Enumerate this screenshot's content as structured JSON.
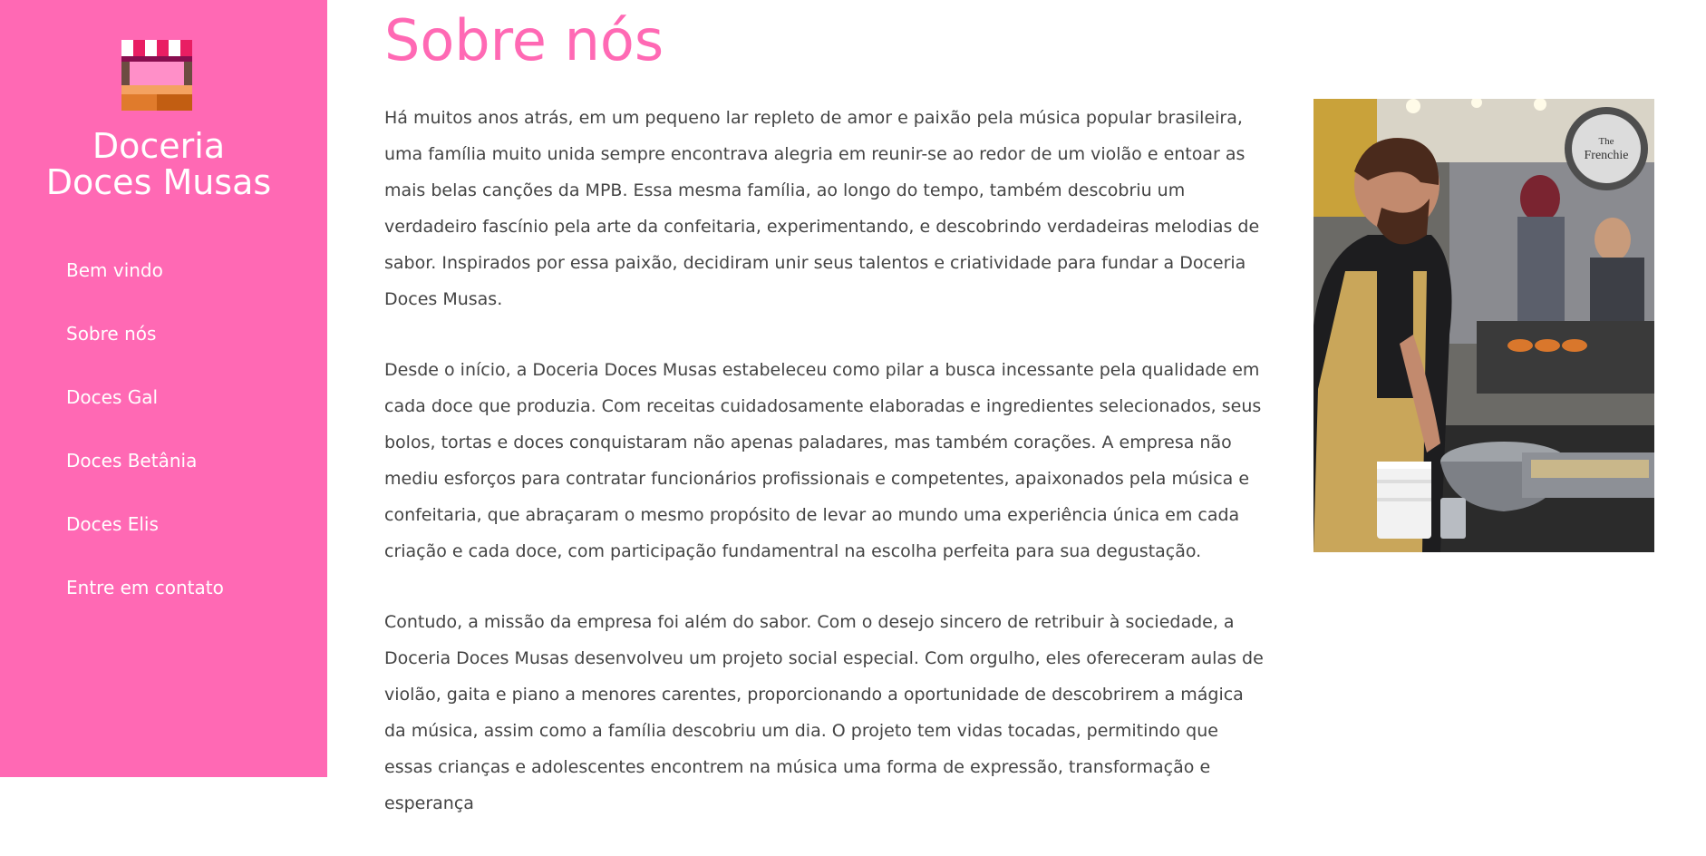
{
  "sidebar": {
    "brand_line1": "Doceria",
    "brand_line2": "Doces Musas",
    "logo_icon": "market-stall-icon",
    "nav": [
      {
        "label": "Bem vindo"
      },
      {
        "label": "Sobre nós"
      },
      {
        "label": "Doces Gal"
      },
      {
        "label": "Doces Betânia"
      },
      {
        "label": "Doces Elis"
      },
      {
        "label": "Entre em contato"
      }
    ]
  },
  "main": {
    "title": "Sobre nós",
    "paragraphs": [
      "Há muitos anos atrás, em um pequeno lar repleto de amor e paixão pela música popular brasileira, uma família muito unida sempre encontrava alegria em reunir-se ao redor de um violão e entoar as mais belas canções da MPB. Essa mesma família, ao longo do tempo, também descobriu um verdadeiro fascínio pela arte da confeitaria, experimentando, e descobrindo verdadeiras melodias de sabor. Inspirados por essa paixão, decidiram unir seus talentos e criatividade para fundar a Doceria Doces Musas.",
      "Desde o início, a Doceria Doces Musas estabeleceu como pilar a busca incessante pela qualidade em cada doce que produzia. Com receitas cuidadosamente elaboradas e ingredientes selecionados, seus bolos, tortas e doces conquistaram não apenas paladares, mas também corações. A empresa não mediu esforços para contratar funcionários profissionais e competentes, apaixonados pela música e confeitaria, que abraçaram o mesmo propósito de levar ao mundo uma experiência única em cada criação e cada doce, com participação fundamentral na escolha perfeita para sua degustação.",
      "Contudo, a missão da empresa foi além do sabor. Com o desejo sincero de retribuir à sociedade, a Doceria Doces Musas desenvolveu um projeto social especial. Com orgulho, eles ofereceram aulas de violão, gaita e piano a menores carentes, proporcionando a oportunidade de descobrirem a mágica da música, assim como a família descobriu um dia. O projeto tem vidas tocadas, permitindo que essas crianças e adolescentes encontrem na música uma forma de expressão, transformação e esperança"
    ],
    "photo_sign_text_1": "The",
    "photo_sign_text_2": "Frenchie"
  },
  "colors": {
    "accent": "#ff69b4",
    "text": "#444444",
    "background": "#ffffff"
  }
}
